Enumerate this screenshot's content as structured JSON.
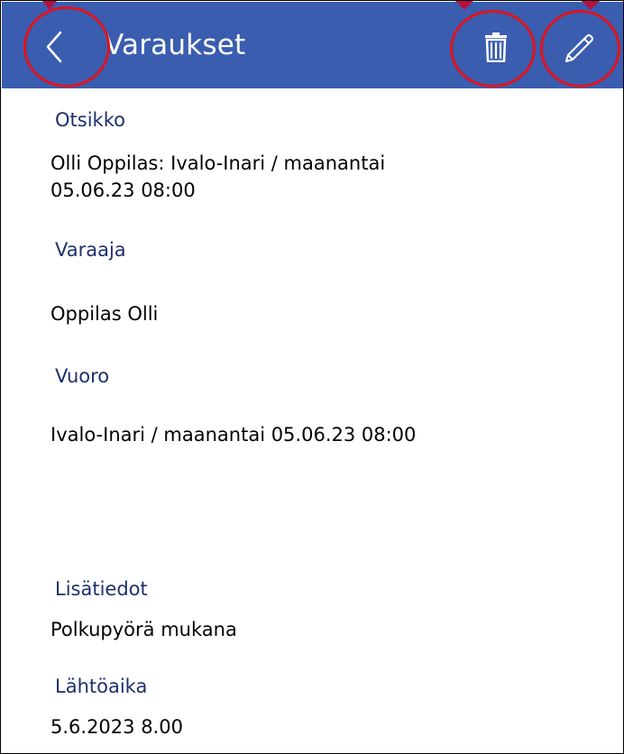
{
  "header": {
    "title": "Varaukset",
    "back_icon": "chevron-left-icon",
    "delete_icon": "trash-icon",
    "edit_icon": "pencil-icon",
    "background": "#3a5daf",
    "highlight_color": "#e0141e"
  },
  "fields": [
    {
      "label": "Otsikko",
      "value_line1": "Olli Oppilas:  Ivalo-Inari / maanantai",
      "value_line2": "05.06.23 08:00"
    },
    {
      "label": "Varaaja",
      "value": "Oppilas Olli"
    },
    {
      "label": "Vuoro",
      "value": "Ivalo-Inari / maanantai 05.06.23 08:00"
    },
    {
      "label": "Lisätiedot",
      "value": "Polkupyörä mukana"
    },
    {
      "label": "Lähtöaika",
      "value": "5.6.2023 8.00"
    }
  ]
}
